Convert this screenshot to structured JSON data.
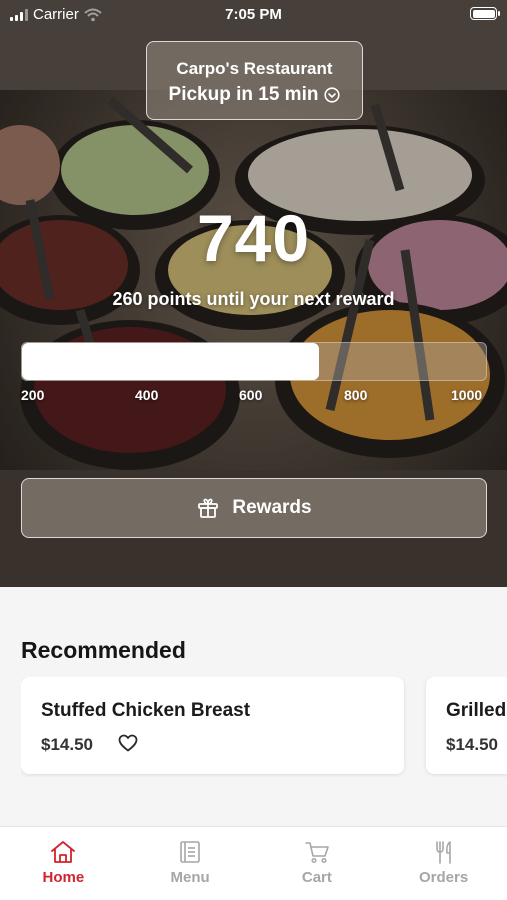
{
  "status_bar": {
    "carrier": "Carrier",
    "time": "7:05 PM"
  },
  "location": {
    "restaurant": "Carpo's Restaurant",
    "pickup": "Pickup in 15 min",
    "icon": "chevron-down-circle-icon"
  },
  "rewards": {
    "points": "740",
    "subtitle": "260 points until your next reward",
    "progress_fraction": 0.64,
    "ticks": [
      "200",
      "400",
      "600",
      "800",
      "1000"
    ],
    "button_label": "Rewards",
    "button_icon": "gift-icon"
  },
  "recommended": {
    "title": "Recommended",
    "items": [
      {
        "name": "Stuffed Chicken Breast",
        "price": "$14.50"
      },
      {
        "name": "Grilled",
        "price": "$14.50"
      }
    ]
  },
  "tabs": [
    {
      "label": "Home",
      "icon": "home-icon",
      "active": true
    },
    {
      "label": "Menu",
      "icon": "menu-icon",
      "active": false
    },
    {
      "label": "Cart",
      "icon": "cart-icon",
      "active": false
    },
    {
      "label": "Orders",
      "icon": "fork-knife-icon",
      "active": false
    }
  ],
  "colors": {
    "accent": "#d0242e",
    "inactive": "#a6a6a6"
  }
}
